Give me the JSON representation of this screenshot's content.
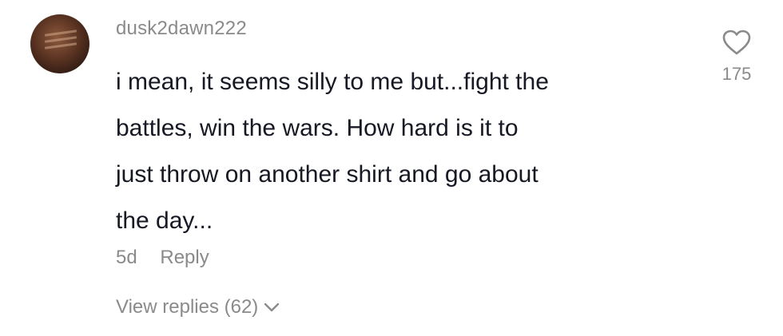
{
  "comment": {
    "username": "dusk2dawn222",
    "text_lines": [
      "i mean, it seems silly to me but...fight the",
      "battles, win the wars. How hard is it to",
      "just throw on another shirt and go about",
      "the day..."
    ],
    "time_ago": "5d",
    "reply_label": "Reply",
    "view_replies_label": "View replies (62)",
    "like_count": "175",
    "icons": {
      "avatar": "avatar",
      "like": "heart-outline-icon",
      "expand": "chevron-down-icon"
    },
    "colors": {
      "text": "#161823",
      "secondary": "#8a8a8a",
      "background": "#ffffff"
    }
  }
}
